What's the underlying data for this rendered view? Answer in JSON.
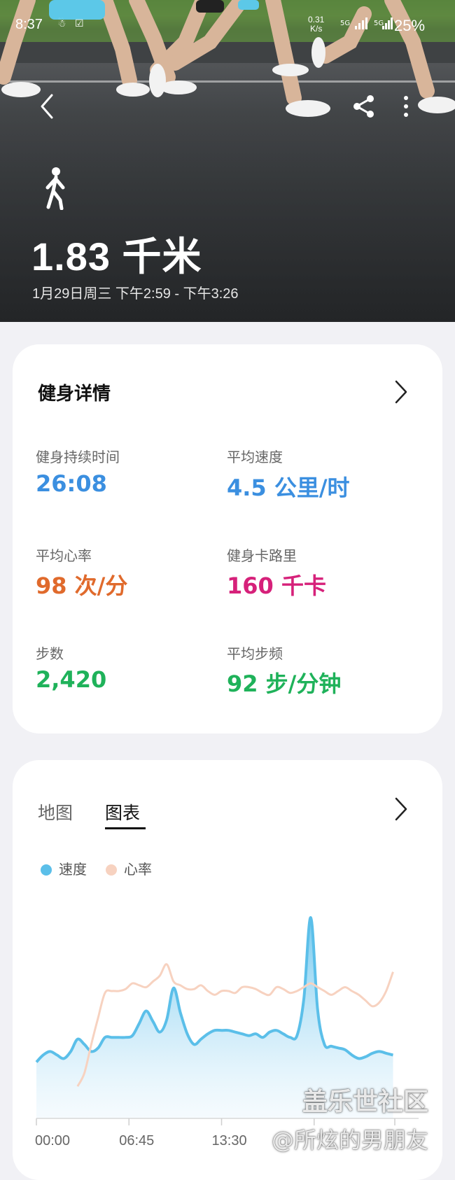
{
  "status_bar": {
    "time": "8:37",
    "net_speed_value": "0.31",
    "net_speed_unit": "K/s",
    "network_1": "5G",
    "network_2": "5G",
    "battery": "25%"
  },
  "hero": {
    "distance": "1.83 千米",
    "datetime": "1月29日周三 下午2:59 - 下午3:26",
    "activity_icon": "walking-person-icon"
  },
  "details": {
    "title": "健身详情",
    "metrics": [
      {
        "label": "健身持续时间",
        "value": "26:08",
        "color": "#3b8fe0"
      },
      {
        "label": "平均速度",
        "value": "4.5 公里/时",
        "color": "#3b8fe0"
      },
      {
        "label": "平均心率",
        "value": "98 次/分",
        "color": "#e06a2c"
      },
      {
        "label": "健身卡路里",
        "value": "160 千卡",
        "color": "#d6217a"
      },
      {
        "label": "步数",
        "value": "2,420",
        "color": "#1fb25a"
      },
      {
        "label": "平均步频",
        "value": "92 步/分钟",
        "color": "#1fb25a"
      }
    ]
  },
  "chart_card": {
    "tabs": [
      {
        "label": "地图",
        "active": false
      },
      {
        "label": "图表",
        "active": true
      }
    ],
    "legend": [
      {
        "label": "速度",
        "color": "#5bbfe9"
      },
      {
        "label": "心率",
        "color": "#f7d2c0"
      }
    ]
  },
  "chart_data": {
    "type": "area",
    "x_ticks": [
      "00:00",
      "06:45",
      "13:30"
    ],
    "x_range_minutes": [
      0,
      26.13
    ],
    "grid": false,
    "legend_position": "top-left",
    "series": [
      {
        "name": "速度",
        "x": [
          0,
          0.5,
          1,
          1.5,
          2,
          2.5,
          3,
          3.5,
          4,
          4.5,
          5,
          5.5,
          6,
          6.5,
          7,
          7.5,
          8,
          8.5,
          9,
          9.5,
          10,
          10.5,
          11,
          11.5,
          12,
          12.5,
          13,
          13.5,
          14,
          14.5,
          15,
          15.5,
          16,
          16.5,
          17,
          17.5,
          18,
          18.5,
          19,
          19.5,
          20,
          20.5,
          21,
          21.5,
          22,
          22.5,
          23,
          23.5,
          24,
          24.5,
          25,
          25.5,
          26
        ],
        "values": [
          3.2,
          3.6,
          3.8,
          3.6,
          3.4,
          3.8,
          4.5,
          4.2,
          3.8,
          4.0,
          4.6,
          4.6,
          4.6,
          4.6,
          4.7,
          5.4,
          6.1,
          5.5,
          4.9,
          5.6,
          7.4,
          6.0,
          4.8,
          4.2,
          4.5,
          4.8,
          5.0,
          5.0,
          5.0,
          4.9,
          4.8,
          4.7,
          4.8,
          4.6,
          4.9,
          5.0,
          4.8,
          4.6,
          4.7,
          6.8,
          11.4,
          6.2,
          4.2,
          4.1,
          4.0,
          3.9,
          3.6,
          3.4,
          3.5,
          3.7,
          3.8,
          3.7,
          3.6
        ]
      },
      {
        "name": "心率",
        "x": [
          3,
          3.5,
          4,
          4.5,
          5,
          5.5,
          6,
          6.5,
          7,
          7.5,
          8,
          8.5,
          9,
          9.5,
          10,
          10.5,
          11,
          11.5,
          12,
          12.5,
          13,
          13.5,
          14,
          14.5,
          15,
          15.5,
          16,
          16.5,
          17,
          17.5,
          18,
          18.5,
          19,
          19.5,
          20,
          20.5,
          21,
          21.5,
          22,
          22.5,
          23,
          23.5,
          24,
          24.5,
          25,
          25.5,
          26
        ],
        "values": [
          68,
          75,
          90,
          104,
          117,
          118,
          118,
          119,
          122,
          121,
          120,
          123,
          126,
          132,
          123,
          121,
          119,
          119,
          121,
          118,
          116,
          118,
          118,
          117,
          120,
          120,
          119,
          117,
          116,
          120,
          119,
          117,
          118,
          120,
          122,
          120,
          118,
          116,
          118,
          120,
          118,
          116,
          113,
          110,
          112,
          118,
          128
        ]
      }
    ],
    "annotation_note_y": "values are relative (no y-axis printed)"
  },
  "watermark": {
    "line1": "盖乐世社区",
    "line2": "@所炫的男朋友"
  }
}
